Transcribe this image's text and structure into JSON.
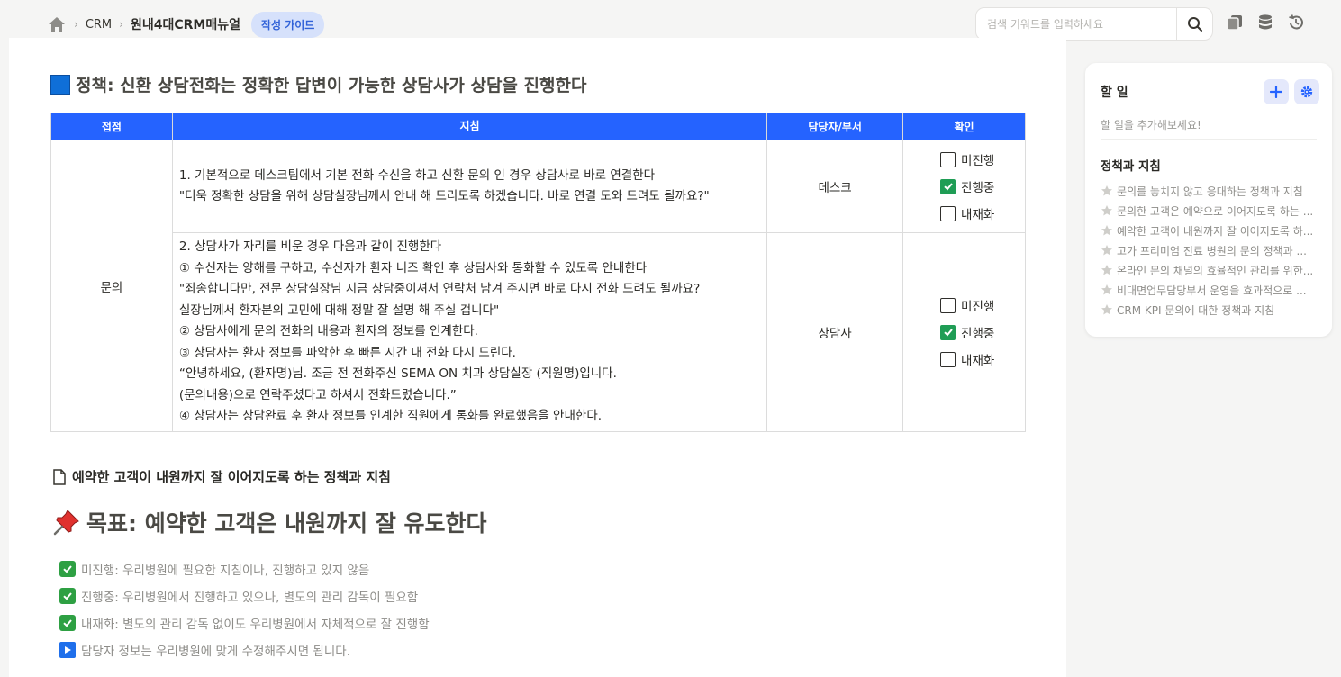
{
  "breadcrumb": {
    "section": "CRM",
    "page": "원내4대CRM매뉴얼",
    "badge": "작성 가이드"
  },
  "search": {
    "placeholder": "검색 키워드를 입력하세요"
  },
  "policy": {
    "heading": "정책: 신환 상담전화는 정확한 답변이 가능한 상담사가 상담을 진행한다",
    "headers": [
      "접점",
      "지침",
      "담당자/부서",
      "확인"
    ],
    "touchpoint": "문의",
    "rows": [
      {
        "lines": [
          "1. 기본적으로 데스크팀에서 기본 전화 수신을 하고 신환 문의 인 경우 상담사로 바로 연결한다",
          "\"더욱 정확한 상담을 위해 상담실장님께서 안내 해 드리도록 하겠습니다. 바로 연결 도와 드려도 될까요?\""
        ],
        "owner": "데스크",
        "checks": [
          {
            "label": "미진행",
            "checked": false
          },
          {
            "label": "진행중",
            "checked": true
          },
          {
            "label": "내재화",
            "checked": false
          }
        ]
      },
      {
        "lines": [
          "2. 상담사가 자리를 비운 경우 다음과 같이 진행한다",
          "① 수신자는 양해를 구하고, 수신자가 환자 니즈 확인 후 상담사와 통화할 수 있도록 안내한다",
          "\"죄송합니다만, 전문 상담실장님 지금 상담중이셔서 연락처 남겨 주시면 바로 다시 전화 드려도 될까요?",
          "실장님께서 환자분의 고민에 대해 정말 잘 설명 해 주실 겁니다\"",
          "② 상담사에게 문의 전화의 내용과 환자의 정보를 인계한다.",
          "③ 상담사는 환자 정보를 파악한 후 빠른 시간 내 전화 다시 드린다.",
          "“안녕하세요, (환자명)님. 조금 전 전화주신 SEMA ON 치과 상담실장 (직원명)입니다.",
          "(문의내용)으로 연락주셨다고 하셔서 전화드렸습니다.”",
          "④ 상담사는 상담완료 후 환자 정보를 인계한 직원에게 통화를 완료했음을 안내한다."
        ],
        "owner": "상담사",
        "checks": [
          {
            "label": "미진행",
            "checked": false
          },
          {
            "label": "진행중",
            "checked": true
          },
          {
            "label": "내재화",
            "checked": false
          }
        ]
      }
    ]
  },
  "subsection": {
    "title": "예약한 고객이 내원까지 잘 이어지도록 하는 정책과 지침"
  },
  "goal": {
    "heading": "목표: 예약한 고객은 내원까지 잘 유도한다"
  },
  "legend": [
    "미진행: 우리병원에 필요한 지침이나, 진행하고 있지 않음",
    "진행중: 우리병원에서 진행하고 있으나, 별도의 관리 감독이 필요함",
    "내재화: 별도의 관리 감독 없이도 우리병원에서 자체적으로 잘 진행함"
  ],
  "note": "담당자 정보는 우리병원에 맞게 수정해주시면 됩니다.",
  "sidebar": {
    "todo_title": "할 일",
    "todo_empty": "할 일을 추가해보세요!",
    "policies_title": "정책과 지침",
    "policies": [
      "문의를 놓치지 않고 응대하는 정책과 지침",
      "문의한 고객은 예약으로 이어지도록 하는 ...",
      "예약한 고객이 내원까지 잘 이어지도록 하...",
      "고가 프리미엄 진료 병원의 문의 정책과 ...",
      "온라인 문의 채널의 효율적인 관리를 위한...",
      "비대면업무담당부서 운영을 효과적으로 ...",
      "CRM KPI 문의에 대한 정책과 지침"
    ]
  },
  "colors": {
    "accent": "#2563ff",
    "check_green": "#1f9d55",
    "badge_bg": "#d6e1fb"
  },
  "icons": [
    "home-icon",
    "search-icon",
    "copy-icon",
    "database-icon",
    "history-icon",
    "plus-icon",
    "gear-icon",
    "star-icon",
    "document-icon",
    "pushpin-icon",
    "check-icon",
    "play-icon"
  ]
}
